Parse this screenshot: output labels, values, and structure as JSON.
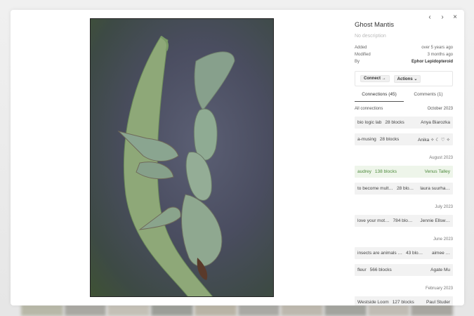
{
  "nav": {
    "prev": "‹",
    "next": "›",
    "close": "×"
  },
  "block": {
    "title": "Ghost Mantis",
    "description": "No description",
    "added_label": "Added",
    "added_value": "over 5 years ago",
    "modified_label": "Modified",
    "modified_value": "3 months ago",
    "by_label": "By",
    "by_value": "Ephor Lepidopteroid"
  },
  "actions": {
    "connect": "Connect →",
    "actions": "Actions ⌄"
  },
  "tabs": [
    {
      "label": "Connections (45)"
    },
    {
      "label": "Comments (1)"
    }
  ],
  "connections": {
    "header_left": "All connections",
    "header_right": "October 2023",
    "groups": [
      {
        "date": "",
        "items": [
          {
            "title": "bio logic lab",
            "blocks": "28 blocks",
            "owner": "Anya Biarozka"
          },
          {
            "title": "a-musing",
            "blocks": "28 blocks",
            "owner": "Anika ✧ ☾ ♡ ✧"
          }
        ]
      },
      {
        "date": "August 2023",
        "items": [
          {
            "title": "audrey",
            "blocks": "138 blocks",
            "owner": "Venus Talley"
          },
          {
            "title": "to become mult…",
            "blocks": "28 blo…",
            "owner": "laura suurha…"
          }
        ]
      },
      {
        "date": "July 2023",
        "items": [
          {
            "title": "love your mot…",
            "blocks": "784 blo…",
            "owner": "Jennie Ellsw…"
          }
        ]
      },
      {
        "date": "June 2023",
        "items": [
          {
            "title": "insects are animals …",
            "blocks": "43 blo…",
            "owner": "aimee …"
          },
          {
            "title": "fleur",
            "blocks": "566 blocks",
            "owner": "Agate Mu"
          }
        ]
      },
      {
        "date": "February 2023",
        "items": [
          {
            "title": "Westside Loom",
            "blocks": "127 blocks",
            "owner": "Paul Studer"
          }
        ]
      }
    ]
  },
  "colors": {
    "highlight_green": "#4d8a3c",
    "card_bg": "#f2f2f2"
  }
}
